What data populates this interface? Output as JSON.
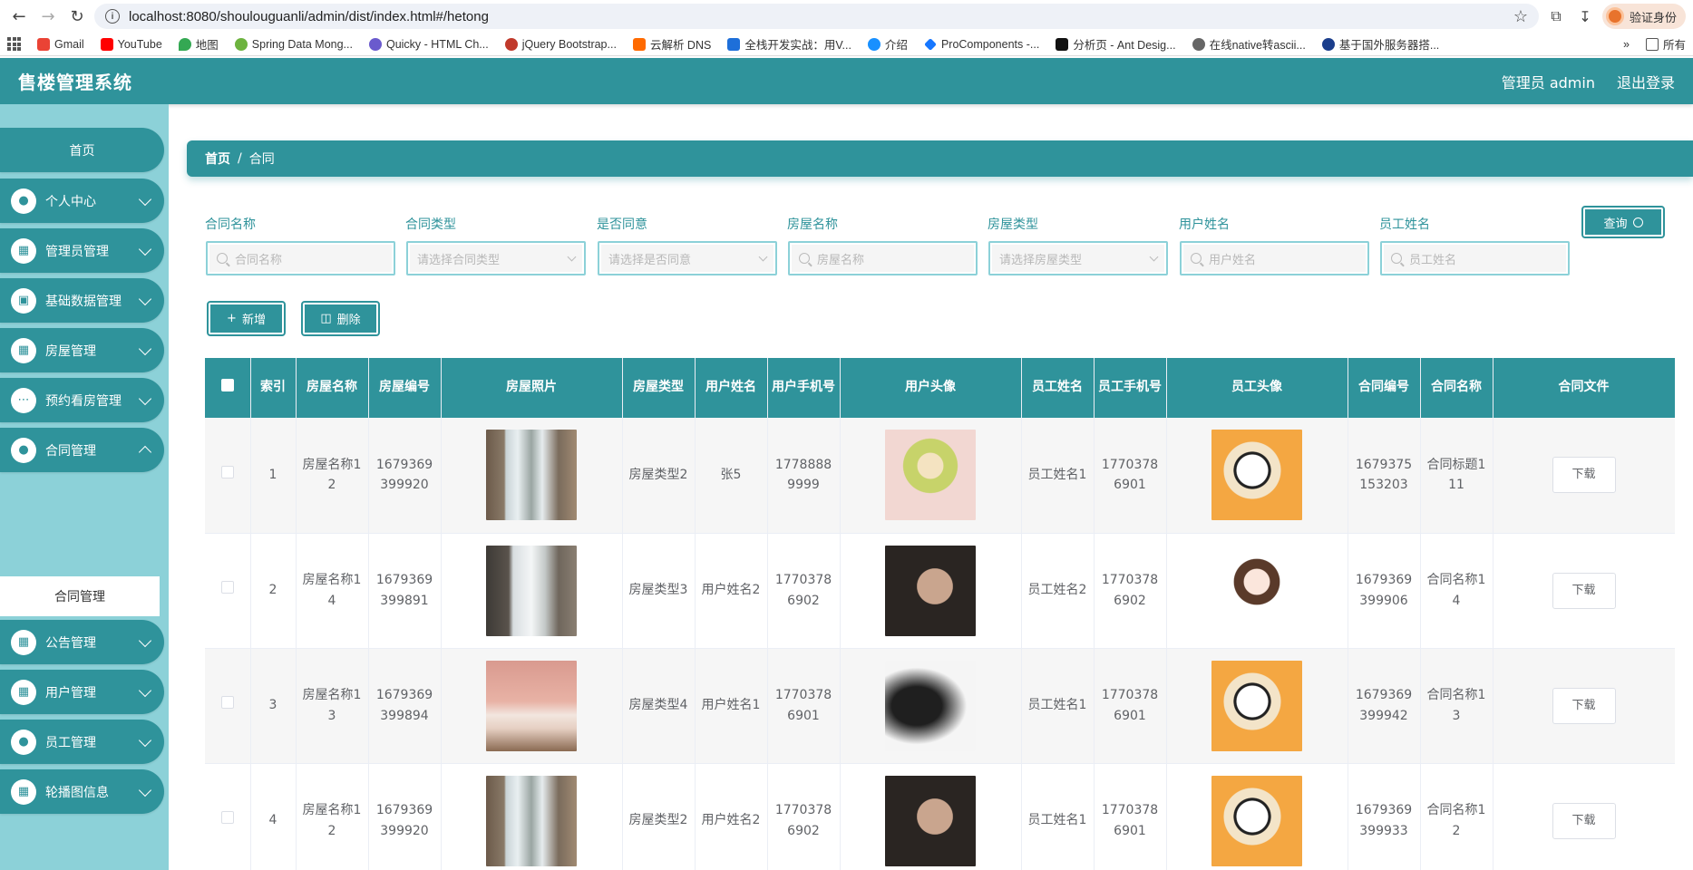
{
  "browser": {
    "url": "localhost:8080/shoulouguanli/admin/dist/index.html#/hetong",
    "profile_label": "验证身份",
    "bookmarks": [
      "Gmail",
      "YouTube",
      "地图",
      "Spring Data Mong...",
      "Quicky - HTML Ch...",
      "jQuery Bootstrap...",
      "云解析 DNS",
      "全栈开发实战：用V...",
      "介绍",
      "ProComponents -...",
      "分析页 - Ant Desig...",
      "在线native转ascii...",
      "基于国外服务器搭...",
      "所有"
    ]
  },
  "header": {
    "title": "售楼管理系统",
    "user_label": "管理员 admin",
    "logout_label": "退出登录"
  },
  "sidebar": {
    "home": "首页",
    "items": [
      {
        "label": "个人中心",
        "icon": "user-icon"
      },
      {
        "label": "管理员管理",
        "icon": "grid-icon"
      },
      {
        "label": "基础数据管理",
        "icon": "briefcase-icon"
      },
      {
        "label": "房屋管理",
        "icon": "grid-icon"
      },
      {
        "label": "预约看房管理",
        "icon": "chat-icon"
      },
      {
        "label": "合同管理",
        "icon": "user-icon"
      },
      {
        "label": "公告管理",
        "icon": "grid-icon"
      },
      {
        "label": "用户管理",
        "icon": "grid-icon"
      },
      {
        "label": "员工管理",
        "icon": "user-icon"
      },
      {
        "label": "轮播图信息",
        "icon": "grid-icon"
      }
    ],
    "submenu_active": "合同管理"
  },
  "breadcrumb": {
    "home": "首页",
    "separator": "/",
    "current": "合同"
  },
  "filters": [
    {
      "label": "合同名称",
      "placeholder": "合同名称",
      "type": "input"
    },
    {
      "label": "合同类型",
      "placeholder": "请选择合同类型",
      "type": "select"
    },
    {
      "label": "是否同意",
      "placeholder": "请选择是否同意",
      "type": "select"
    },
    {
      "label": "房屋名称",
      "placeholder": "房屋名称",
      "type": "input"
    },
    {
      "label": "房屋类型",
      "placeholder": "请选择房屋类型",
      "type": "select"
    },
    {
      "label": "用户姓名",
      "placeholder": "用户姓名",
      "type": "input"
    },
    {
      "label": "员工姓名",
      "placeholder": "员工姓名",
      "type": "input"
    }
  ],
  "buttons": {
    "query": "查询",
    "add": "新增",
    "delete": "删除"
  },
  "table": {
    "headers": [
      "索引",
      "房屋名称",
      "房屋编号",
      "房屋照片",
      "房屋类型",
      "用户姓名",
      "用户手机号",
      "用户头像",
      "员工姓名",
      "员工手机号",
      "员工头像",
      "合同编号",
      "合同名称",
      "合同文件"
    ],
    "download_label": "下载",
    "rows": [
      {
        "index": "1",
        "house_name": "房屋名称12",
        "house_no": "1679369399920",
        "house_type": "房屋类型2",
        "user_name": "张5",
        "user_phone": "17788889999",
        "staff_name": "员工姓名1",
        "staff_phone": "17703786901",
        "contract_no": "1679375153203",
        "contract_name": "合同标题111"
      },
      {
        "index": "2",
        "house_name": "房屋名称14",
        "house_no": "1679369399891",
        "house_type": "房屋类型3",
        "user_name": "用户姓名2",
        "user_phone": "17703786902",
        "staff_name": "员工姓名2",
        "staff_phone": "17703786902",
        "contract_no": "1679369399906",
        "contract_name": "合同名称14"
      },
      {
        "index": "3",
        "house_name": "房屋名称13",
        "house_no": "1679369399894",
        "house_type": "房屋类型4",
        "user_name": "用户姓名1",
        "user_phone": "17703786901",
        "staff_name": "员工姓名1",
        "staff_phone": "17703786901",
        "contract_no": "1679369399942",
        "contract_name": "合同名称13"
      },
      {
        "index": "4",
        "house_name": "房屋名称12",
        "house_no": "1679369399920",
        "house_type": "房屋类型2",
        "user_name": "用户姓名2",
        "user_phone": "17703786902",
        "staff_name": "员工姓名1",
        "staff_phone": "17703786901",
        "contract_no": "1679369399933",
        "contract_name": "合同名称12"
      }
    ]
  },
  "colors": {
    "primary": "#2f939b",
    "sidebar_bg": "#8cd1d8",
    "header_text": "#ffffff"
  }
}
